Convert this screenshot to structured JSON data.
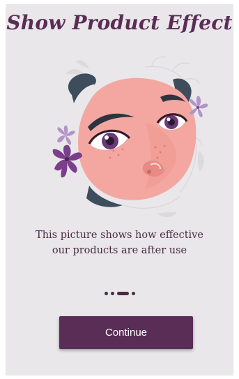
{
  "title": "Show Product Effect",
  "illustration": {
    "icon": "woman-face-illustration",
    "colors": {
      "skin": "#f4a7a0",
      "hair": "#3d4d5c",
      "eye": "#6a3a7a",
      "flower": "#7b3e8c",
      "flower_light": "#b394c6"
    }
  },
  "caption": {
    "line1": "This picture shows how effective",
    "line2": "our products are after use"
  },
  "pager": {
    "count": 4,
    "active_index": 2
  },
  "continue_label": "Continue",
  "colors": {
    "accent": "#5a2d57",
    "background": "#e9e7e9",
    "text": "#4a2a46"
  }
}
